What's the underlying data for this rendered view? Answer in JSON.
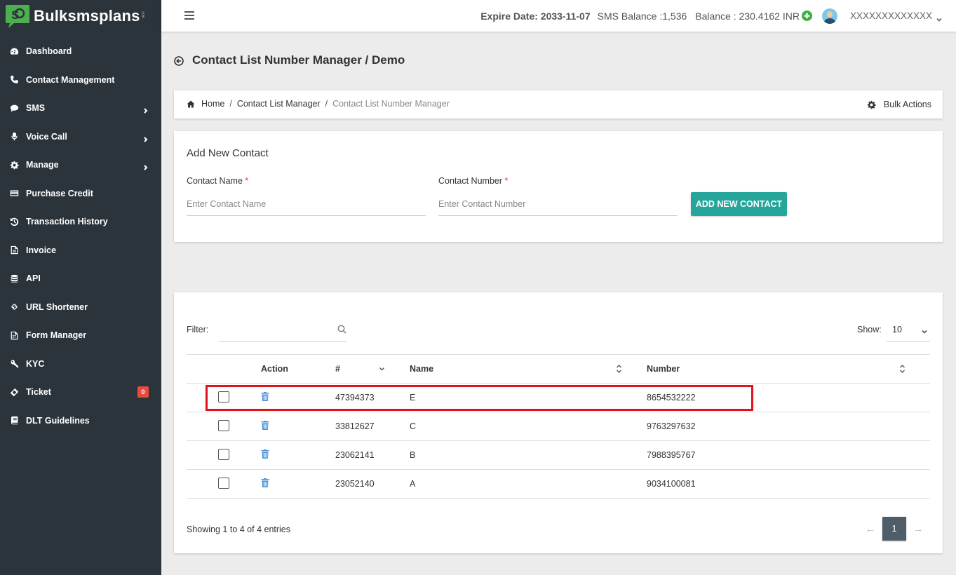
{
  "brand": {
    "name": "Bulksmsplans",
    "suffix": ".com"
  },
  "sidebar": {
    "items": [
      {
        "label": "Dashboard",
        "icon": "dashboard-icon"
      },
      {
        "label": "Contact Management",
        "icon": "phone-icon"
      },
      {
        "label": "SMS",
        "icon": "chat-icon",
        "expandable": true
      },
      {
        "label": "Voice Call",
        "icon": "microphone-icon",
        "expandable": true
      },
      {
        "label": "Manage",
        "icon": "gear-icon",
        "expandable": true
      },
      {
        "label": "Purchase Credit",
        "icon": "credit-card-icon"
      },
      {
        "label": "Transaction History",
        "icon": "history-icon"
      },
      {
        "label": "Invoice",
        "icon": "pdf-file-icon"
      },
      {
        "label": "API",
        "icon": "database-icon"
      },
      {
        "label": "URL Shortener",
        "icon": "link-icon"
      },
      {
        "label": "Form Manager",
        "icon": "form-file-icon"
      },
      {
        "label": "KYC",
        "icon": "key-icon"
      },
      {
        "label": "Ticket",
        "icon": "ticket-icon",
        "badge": "0"
      },
      {
        "label": "DLT Guidelines",
        "icon": "book-icon"
      }
    ]
  },
  "topbar": {
    "expire": "Expire Date: 2033-11-07",
    "sms_balance": "SMS Balance :1,536",
    "balance": "Balance : 230.4162 INR",
    "user": "XXXXXXXXXXXXX",
    "accent": "#3cb043"
  },
  "page": {
    "title": "Contact List Number Manager / Demo"
  },
  "breadcrumb": {
    "home": "Home",
    "level2": "Contact List Manager",
    "current": "Contact List Number Manager",
    "bulk_actions": "Bulk Actions"
  },
  "add_contact": {
    "title": "Add New Contact",
    "name_label": "Contact Name",
    "number_label": "Contact Number",
    "required_mark": "*",
    "name_placeholder": "Enter Contact Name",
    "number_placeholder": "Enter Contact Number",
    "button": "ADD NEW CONTACT",
    "button_color": "#26a69a"
  },
  "table": {
    "filter_label": "Filter:",
    "show_label": "Show:",
    "show_value": "10",
    "columns": {
      "action": "Action",
      "id": "#",
      "name": "Name",
      "number": "Number"
    },
    "rows": [
      {
        "id": "47394373",
        "name": "E",
        "number": "8654532222",
        "highlighted": true
      },
      {
        "id": "33812627",
        "name": "C",
        "number": "9763297632"
      },
      {
        "id": "23062141",
        "name": "B",
        "number": "7988395767"
      },
      {
        "id": "23052140",
        "name": "A",
        "number": "9034100081"
      }
    ],
    "entries": "Showing 1 to 4 of 4 entries",
    "pager": {
      "prev": "←",
      "page": "1",
      "next": "→"
    },
    "highlight_color": "#e0131c"
  }
}
